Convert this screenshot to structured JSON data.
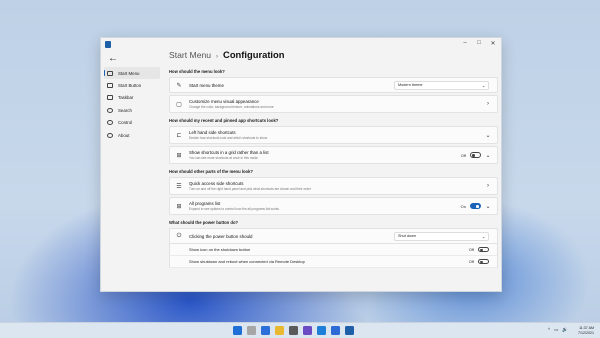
{
  "window": {
    "min": "–",
    "max": "□",
    "close": "✕"
  },
  "nav": {
    "back": "←",
    "items": [
      {
        "label": "Start Menu",
        "icon": "start-menu-icon"
      },
      {
        "label": "Start Button",
        "icon": "start-button-icon"
      },
      {
        "label": "Taskbar",
        "icon": "taskbar-icon"
      },
      {
        "label": "Search",
        "icon": "search-icon"
      },
      {
        "label": "Control",
        "icon": "control-icon"
      },
      {
        "label": "About",
        "icon": "about-icon"
      }
    ]
  },
  "breadcrumb": {
    "parent": "Start Menu",
    "sep": "›",
    "current": "Configuration"
  },
  "sections": {
    "look": "How should the menu look?",
    "shortcuts": "How should my recent and pinned app shortcuts look?",
    "other": "How should other parts of the menu look?",
    "power": "What should the power button do?"
  },
  "cards": {
    "theme": {
      "title": "Start menu theme",
      "value": "Modern theme",
      "caret": "⌄"
    },
    "customize": {
      "title": "Customize menu visual appearance",
      "desc": "Change the color, background texture, animations and more",
      "chev": "›"
    },
    "lefthand": {
      "title": "Left hand side shortcuts",
      "desc": "Decide how shortcuts look and which shortcuts to show",
      "chev": "⌄"
    },
    "grid": {
      "title": "Show shortcuts in a grid rather than a list",
      "desc": "You can see more shortcuts at once in this mode",
      "state": "Off",
      "chev": "⌄"
    },
    "quick": {
      "title": "Quick access side shortcuts",
      "desc": "Turn on and off the right hand panel and pick what shortcuts are shown and their order",
      "chev": "›"
    },
    "allprog": {
      "title": "All programs list",
      "desc": "Expand to see options to control how the all programs list works",
      "state": "On",
      "chev": "⌄"
    },
    "power": {
      "title": "Clicking the power button should",
      "value": "Shut down",
      "caret": "⌄"
    },
    "showicon": {
      "title": "Show icon on the shutdown button",
      "state": "Off"
    },
    "remote": {
      "title": "Show shutdown and reboot when connected via Remote Desktop",
      "state": "Off"
    }
  },
  "taskbar": {
    "tray": {
      "chevron": "^",
      "net": "▭",
      "vol": "🔊"
    },
    "time": "11:37 AM",
    "date": "7/12/2021",
    "colors": [
      "#1f6fd6",
      "#a6a6a6",
      "#2c6fd8",
      "#e8b830",
      "#5a5a5a",
      "#6b4bc4",
      "#1d7fd8",
      "#2d6ad5",
      "#1f5fa8"
    ]
  }
}
